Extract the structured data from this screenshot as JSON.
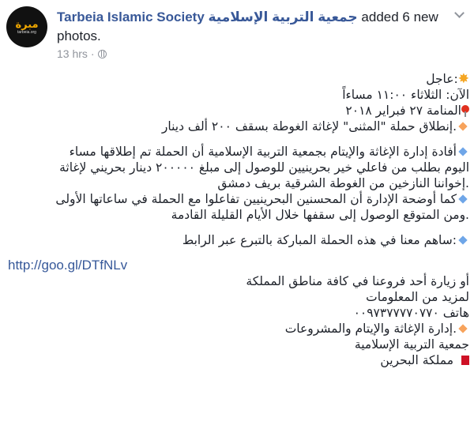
{
  "header": {
    "avatar_logo_text": "مبرة",
    "avatar_logo_sub": "tarbeia.org",
    "page_name": "Tarbeia Islamic Society جمعية التربية الإسلامية",
    "action_text": " added 6 new photos.",
    "timestamp": "13 hrs",
    "privacy_icon": "globe-icon",
    "menu_icon": "chevron-down-icon"
  },
  "post": {
    "l1": ":عاجل",
    "l2": "الآن: الثلاثاء ١١:٠٠ مساءاً",
    "l3": "المنامة ٢٧ فبراير ٢٠١٨",
    "l4": ".إنطلاق حملة \"المثنى\" لإغاثة الغوطة بسقف ٢٠٠ ألف دينار",
    "p2_1": "أفادة إدارة الإغاثة والإيتام بجمعية التربية الإسلامية أن الحملة تم إطلاقها مساء",
    "p2_2": "اليوم بطلب من فاعلي خير بحرينيين للوصول إلى مبلغ ٢٠٠٠٠٠ دينار بحريني لإغاثة",
    "p2_3": ".إخواننا النازخين من الغوطة الشرقية بريف دمشق",
    "p3_1": "كما أوضحة الإدارة أن المحسنين البحرينيين تفاعلوا مع الحملة في ساعاتها الأولى",
    "p3_2": ".ومن المتوقع الوصول إلى سقفها خلال الأيام القليلة القادمة",
    "p4": ":ساهم معنا في هذه الحملة المباركة بالتبرع عبر الرابط",
    "link": "http://goo.gl/DTfNLv",
    "p5_1": "أو زيارة أحد فروعنا في كافة مناطق المملكة",
    "p5_2": "لمزيد من المعلومات",
    "p5_3": "هاتف ٠٠٩٧٣٧٧٧٧٠٧٧٠",
    "p5_4": ".إدارة الإغاثة والإيتام والمشروعات",
    "p5_5": "جمعية التربية الإسلامية",
    "p5_6": "مملكة البحرين"
  },
  "colors": {
    "page_link": "#385898",
    "url_link": "#365899",
    "meta_text": "#90949c",
    "diamond_blue": "#6fa6e8",
    "diamond_orange": "#f7a35c"
  },
  "emoji": {
    "burst": "collision-icon",
    "pin": "round-pushpin-icon",
    "blue_diamond": "small-blue-diamond-icon",
    "orange_diamond": "small-orange-diamond-icon",
    "flag": "bahrain-flag-icon"
  }
}
